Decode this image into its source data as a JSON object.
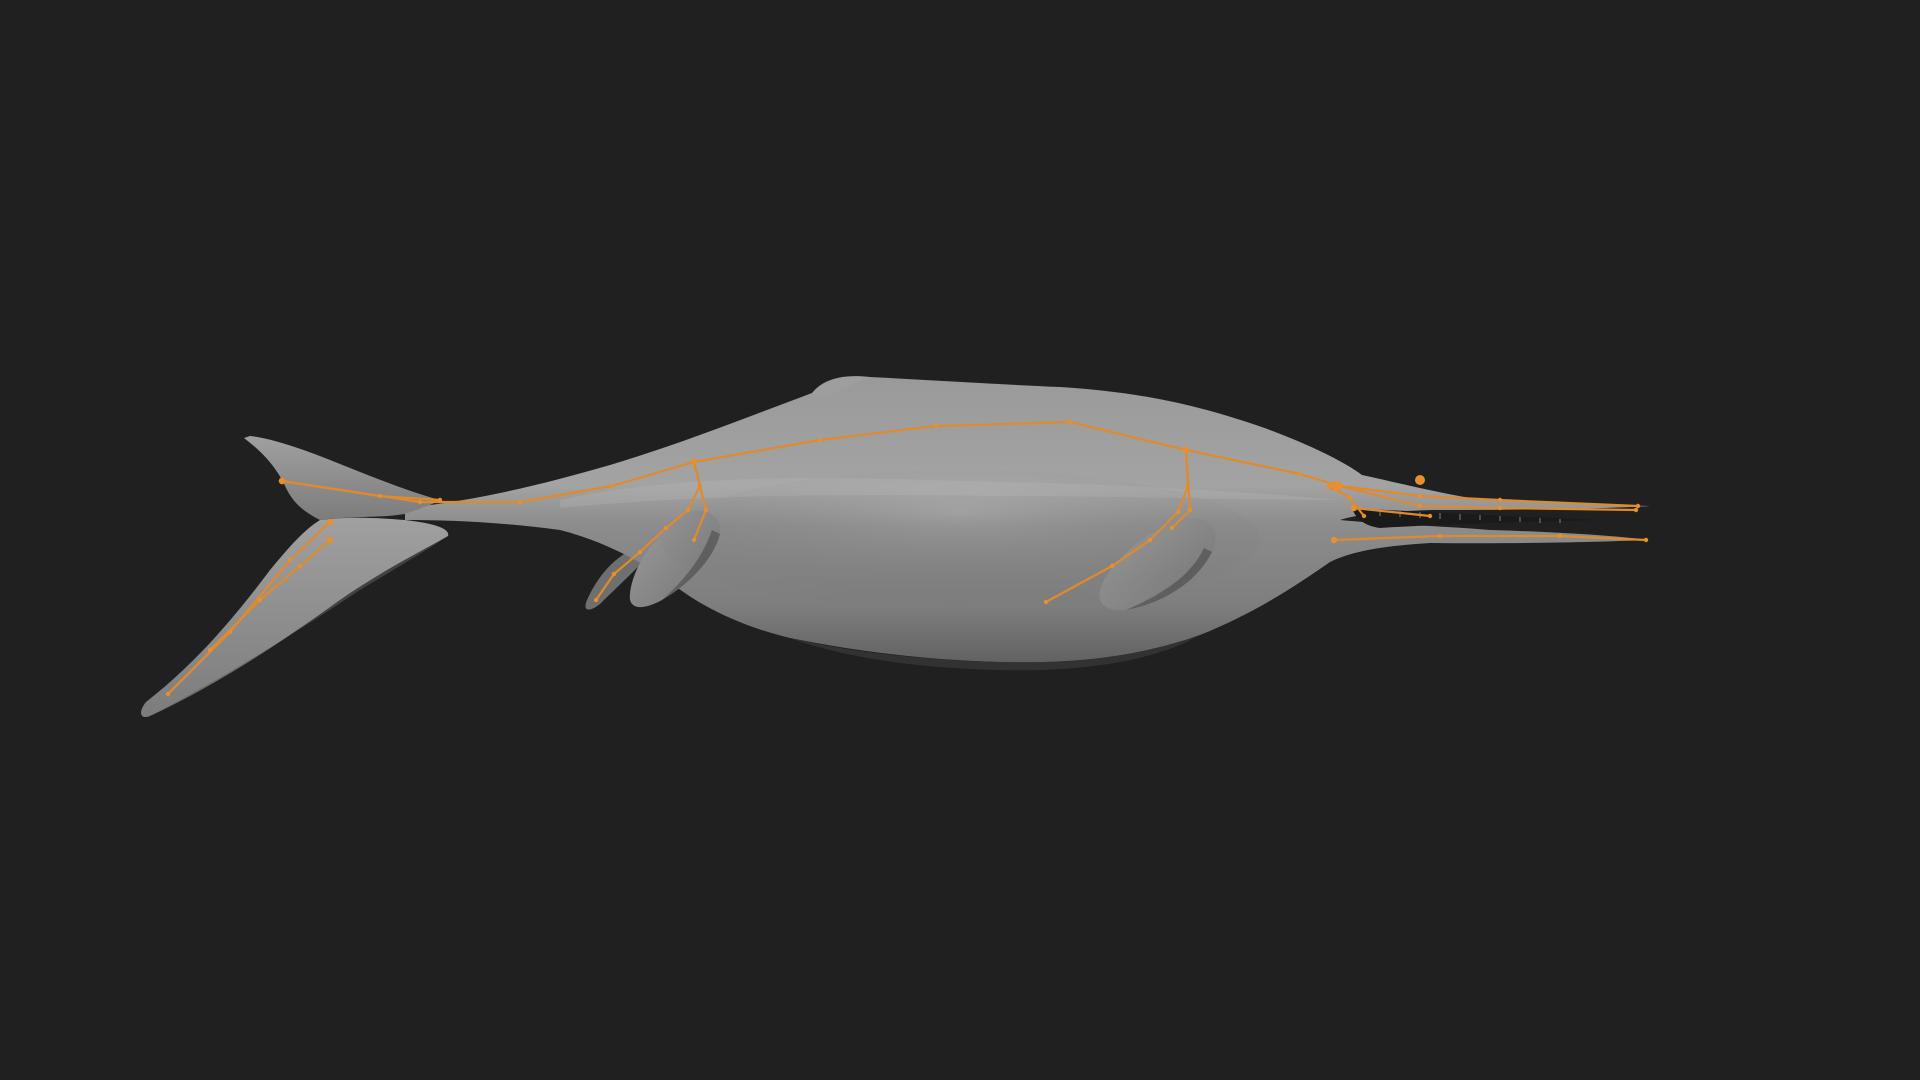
{
  "viewport": {
    "background": "#202020",
    "mode": "3d-viewport-pose-view"
  },
  "model": {
    "name_icon": "ichthyosaur-mesh",
    "body_color": "#8e8e8e",
    "highlight_color": "#a9a9a9",
    "shadow_color": "#5c5c5c"
  },
  "armature": {
    "bone_color": "#e08a2e",
    "joint_color": "#e6902f"
  }
}
